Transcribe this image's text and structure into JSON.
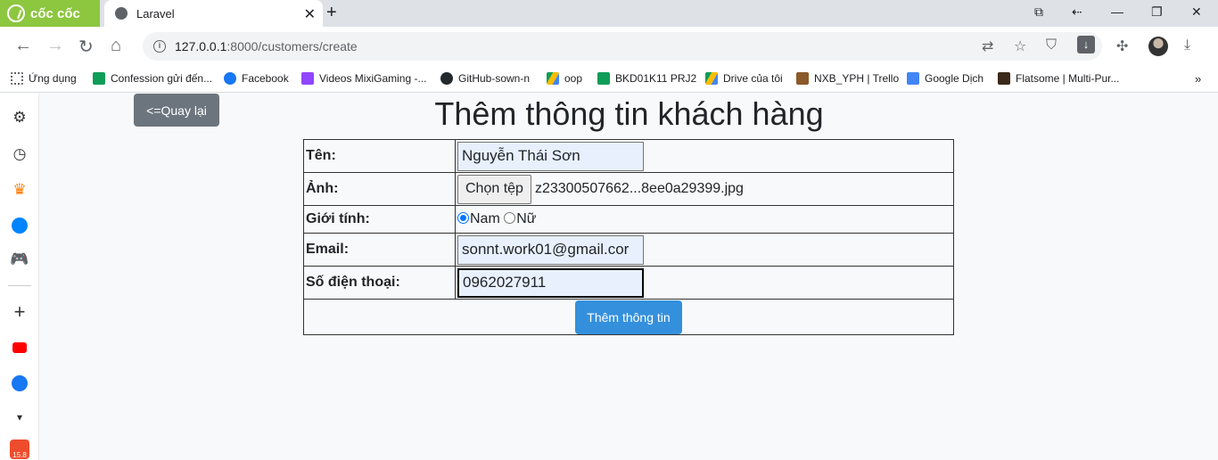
{
  "browser": {
    "brand": "cốc cốc",
    "tab_title": "Laravel",
    "url_host": "127.0.0.1",
    "url_path": ":8000/customers/create"
  },
  "bookmarks": [
    {
      "label": "Ứng dụng",
      "color": "#5f6368"
    },
    {
      "label": "Confession gửi đến...",
      "color": "#0f9d58"
    },
    {
      "label": "Facebook",
      "color": "#1877f2"
    },
    {
      "label": "Videos MixiGaming -...",
      "color": "#9146ff"
    },
    {
      "label": "GitHub-sown-n",
      "color": "#24292e"
    },
    {
      "label": "oop",
      "color": "#fbbc04"
    },
    {
      "label": "BKD01K11 PRJ2",
      "color": "#0f9d58"
    },
    {
      "label": "Drive của tôi",
      "color": "#fbbc04"
    },
    {
      "label": "NXB_YPH | Trello",
      "color": "#8b5a2b"
    },
    {
      "label": "Google Dịch",
      "color": "#4285f4"
    },
    {
      "label": "Flatsome | Multi-Pur...",
      "color": "#3b2a1a"
    }
  ],
  "page": {
    "back_label": "<=Quay lại",
    "title": "Thêm thông tin khách hàng",
    "form": {
      "name_label": "Tên:",
      "name_value": "Nguyễn Thái Sơn",
      "photo_label": "Ảnh:",
      "file_button": "Chọn tệp",
      "file_name": "z23300507662...8ee0a29399.jpg",
      "gender_label": "Giới tính:",
      "gender_male": "Nam",
      "gender_female": "Nữ",
      "gender_selected": "Nam",
      "email_label": "Email:",
      "email_value": "sonnt.work01@gmail.cor",
      "phone_label": "Số điện thoại:",
      "phone_value": "0962027911",
      "submit_label": "Thêm thông tin"
    }
  },
  "sidebar_badge": "15.8"
}
